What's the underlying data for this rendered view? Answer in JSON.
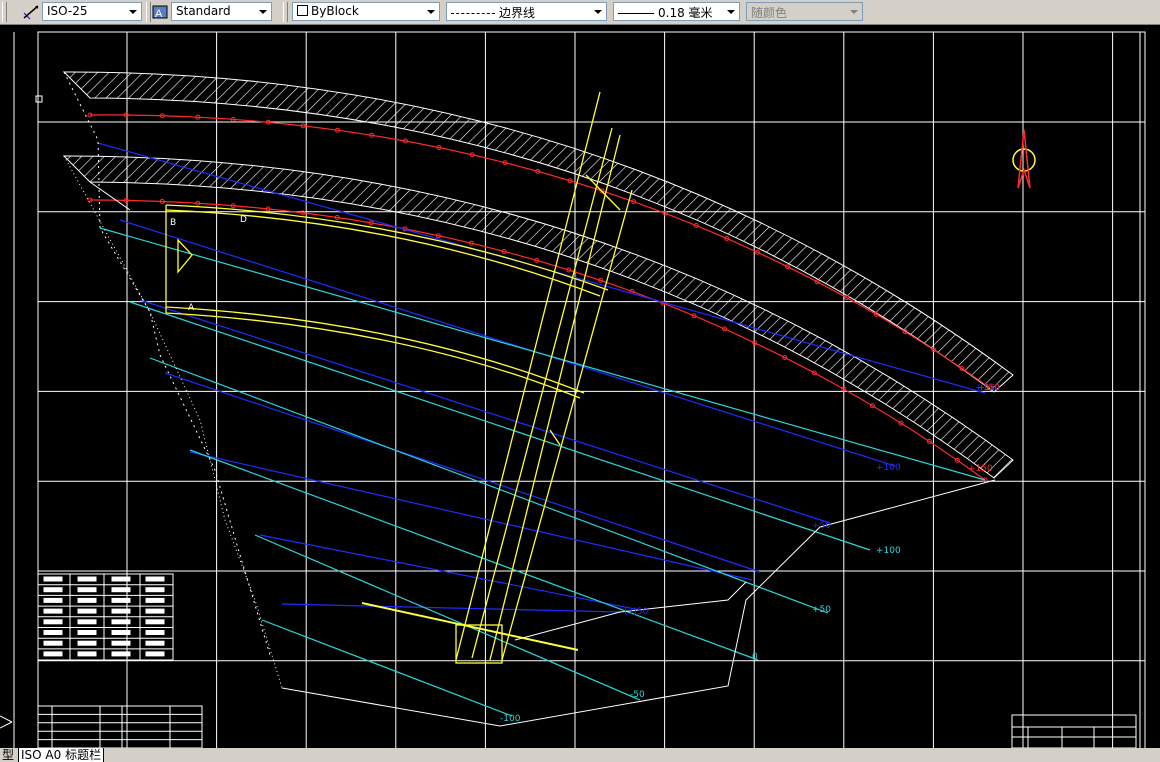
{
  "toolbar": {
    "dimstyle": "ISO-25",
    "textstyle": "Standard",
    "color": "ByBlock",
    "linetype": "边界线",
    "lineweight": "0.18 毫米",
    "plotstyle": "随颜色"
  },
  "drawing": {
    "contours_cyan": [
      "+100",
      "+50",
      "0",
      "-50",
      "-100"
    ],
    "contours_blue": [
      "+150",
      "+100",
      "+50",
      "(3)50"
    ],
    "contours_red": [
      "+150",
      "+150"
    ],
    "labels_misc": [
      "D",
      "A",
      "B"
    ]
  },
  "tabs": {
    "model": "型",
    "layout": "ISO A0 标题栏"
  },
  "colors": {
    "background": "#000000",
    "grid": "#ffffff",
    "red": "#ff2a2a",
    "blue": "#1f2cff",
    "cyan": "#2ad6d6",
    "yellow": "#ffff3a"
  }
}
